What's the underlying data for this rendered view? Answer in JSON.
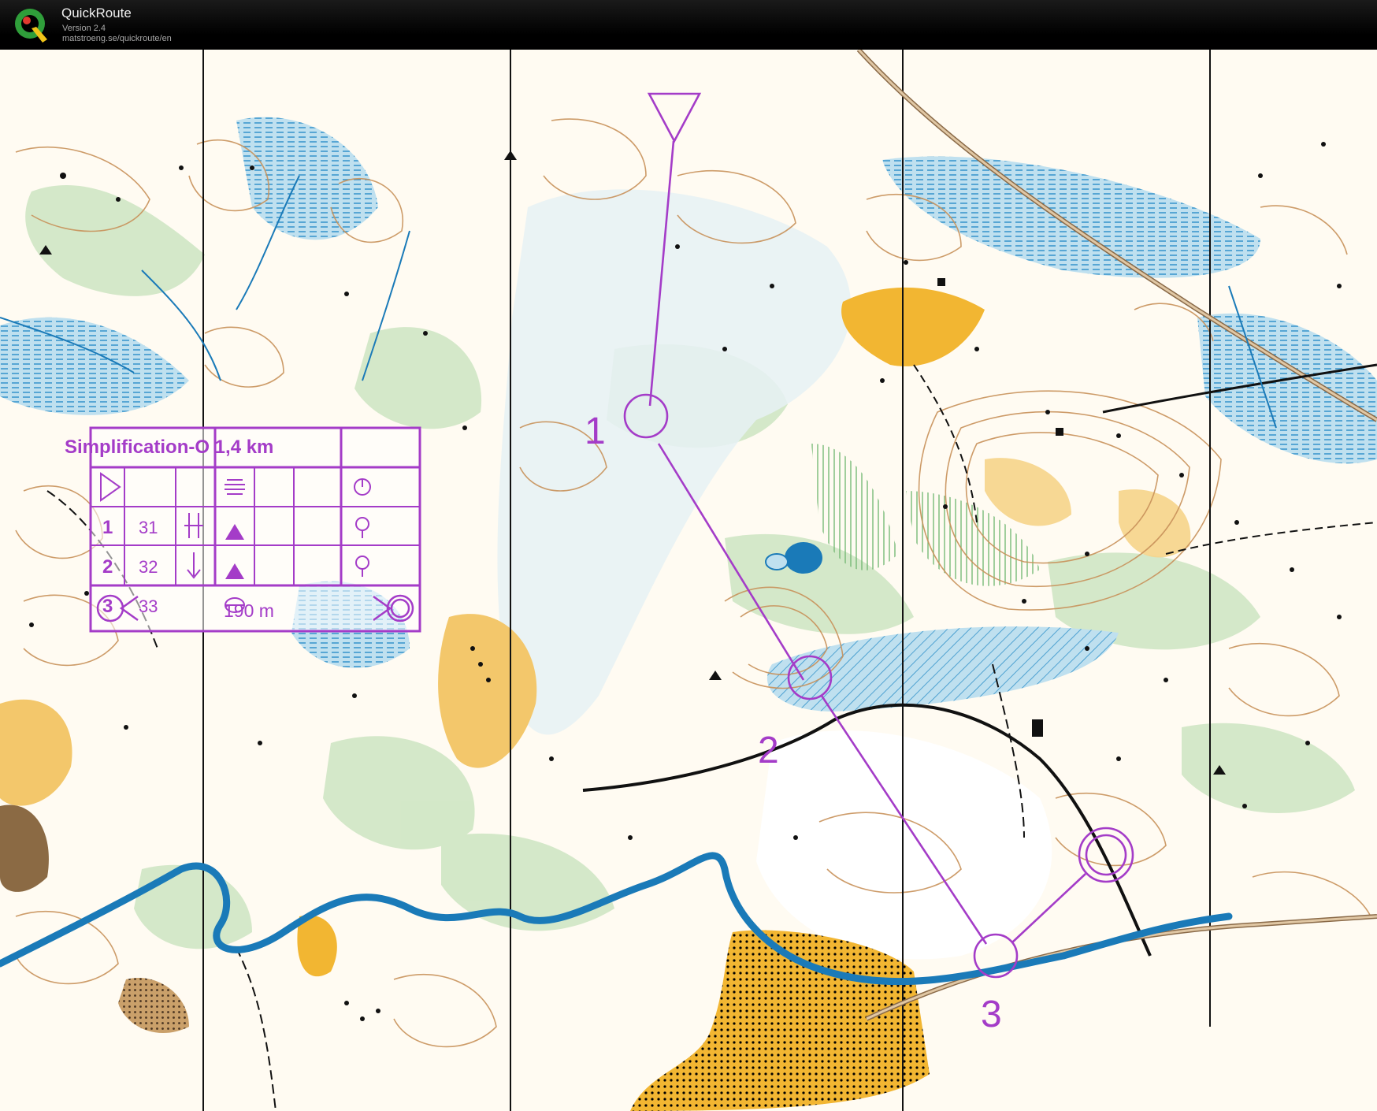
{
  "app": {
    "name": "QuickRoute",
    "version": "Version 2.4",
    "url": "matstroeng.se/quickroute/en",
    "icon": "quickroute-q-logo-icon"
  },
  "map": {
    "type": "orienteering-map",
    "course_color": "#a43cc8",
    "legend": {
      "title": "Simplification-O 1,4 km",
      "rows": [
        {
          "number": "1",
          "code": "31"
        },
        {
          "number": "2",
          "code": "32"
        },
        {
          "number": "3",
          "code": "33"
        }
      ],
      "finish_distance": "190 m"
    },
    "controls": [
      {
        "label": "1"
      },
      {
        "label": "2"
      },
      {
        "label": "3"
      }
    ]
  }
}
